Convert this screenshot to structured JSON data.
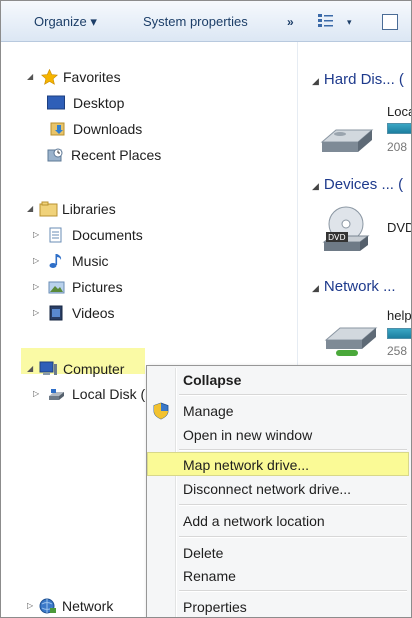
{
  "toolbar": {
    "organize_label": "Organize ▾",
    "system_properties_label": "System properties",
    "more_label": "»",
    "view_arrow": "▾"
  },
  "nav": {
    "favorites": {
      "label": "Favorites",
      "items": [
        "Desktop",
        "Downloads",
        "Recent Places"
      ]
    },
    "libraries": {
      "label": "Libraries",
      "items": [
        "Documents",
        "Music",
        "Pictures",
        "Videos"
      ]
    },
    "computer": {
      "label": "Computer",
      "items": [
        "Local Disk ("
      ]
    },
    "network": {
      "label": "Network"
    }
  },
  "content": {
    "groups": [
      {
        "label": "Hard Dis... ("
      },
      {
        "label": "Devices ... ("
      },
      {
        "label": "Network ..."
      }
    ],
    "items": [
      {
        "label": "Loca",
        "sub": "208",
        "fill": 0.95
      },
      {
        "label": "DVD"
      },
      {
        "label": "help",
        "sub": "258",
        "fill": 0.95
      }
    ]
  },
  "context_menu": {
    "items": [
      {
        "label": "Collapse",
        "bold": true
      },
      {
        "label": "Manage",
        "icon": "shield-icon"
      },
      {
        "label": "Open in new window"
      },
      {
        "label": "Map network drive...",
        "highlighted": true
      },
      {
        "label": "Disconnect network drive..."
      },
      {
        "label": "Add a network location"
      },
      {
        "label": "Delete"
      },
      {
        "label": "Rename"
      },
      {
        "label": "Properties"
      }
    ]
  },
  "colors": {
    "highlight": "#fafa96",
    "toolbar_text": "#1c3e68",
    "group_header": "#1e3a8c",
    "drive_bar": "#1d7fa0"
  }
}
